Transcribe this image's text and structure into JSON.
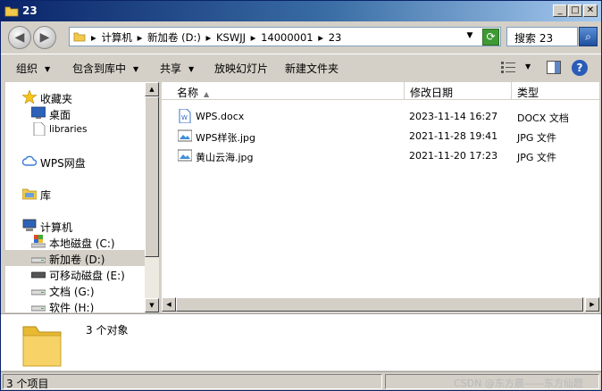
{
  "window": {
    "title": "23",
    "min_label": "_",
    "max_label": "□",
    "close_label": "✕"
  },
  "address": {
    "crumbs": [
      "▸",
      "计算机",
      "▸",
      "新加卷 (D:)",
      "▸",
      "KSWJJ",
      "▸",
      "14000001",
      "▸",
      "23"
    ],
    "dropdown": "▼",
    "refresh": "⟳"
  },
  "search": {
    "placeholder": "搜索 23",
    "button": "⌕"
  },
  "toolbar": {
    "organize": "组织",
    "include_in_library": "包含到库中",
    "share": "共享",
    "slideshow": "放映幻灯片",
    "new_folder": "新建文件夹",
    "dropdown_arrow": "▼",
    "help": "?"
  },
  "nav": {
    "favorites": "收藏夹",
    "desktop": "桌面",
    "libraries_link": "libraries",
    "wps_drive": "WPS网盘",
    "library": "库",
    "computer": "计算机",
    "local_disk": "本地磁盘 (C:)",
    "new_volume": "新加卷 (D:)",
    "removable_disk": "可移动磁盘 (E:)",
    "documents_g": "文档 (G:)",
    "software_h": "软件 (H:)"
  },
  "columns": {
    "name": "名称",
    "date": "修改日期",
    "type": "类型",
    "sort_caret": "▲"
  },
  "files": [
    {
      "name": "WPS.docx",
      "date": "2023-11-14 16:27",
      "type": "DOCX 文档",
      "icon": "docx-icon"
    },
    {
      "name": "WPS样张.jpg",
      "date": "2021-11-28 19:41",
      "type": "JPG 文件",
      "icon": "jpg-icon"
    },
    {
      "name": "黄山云海.jpg",
      "date": "2021-11-20 17:23",
      "type": "JPG 文件",
      "icon": "jpg-icon"
    }
  ],
  "details": {
    "count_text": "3 个对象"
  },
  "status": {
    "items_text": "3 个项目",
    "watermark": "CSDN @东方晨——东方仙题"
  },
  "colors": {
    "title_gradient_start": "#0a246a",
    "title_gradient_end": "#a6caf0",
    "chrome": "#d4d0c8",
    "refresh_green": "#3f9a34",
    "folder_yellow": "#f2c94c"
  }
}
